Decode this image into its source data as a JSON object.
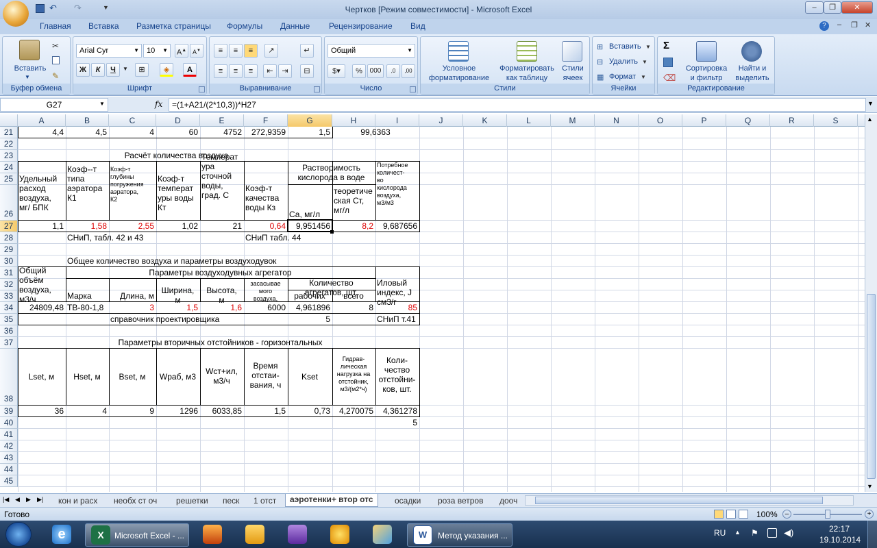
{
  "window": {
    "title": "Чертков  [Режим совместимости] - Microsoft Excel"
  },
  "ribbon": {
    "tabs": [
      "Главная",
      "Вставка",
      "Разметка страницы",
      "Формулы",
      "Данные",
      "Рецензирование",
      "Вид"
    ],
    "clipboard": {
      "label": "Буфер обмена",
      "paste": "Вставить"
    },
    "font": {
      "label": "Шрифт",
      "name": "Arial Cyr",
      "size": "10",
      "bold": "Ж",
      "italic": "К",
      "underline": "Ч"
    },
    "alignment": {
      "label": "Выравнивание"
    },
    "number": {
      "label": "Число",
      "format": "Общий",
      "percent": "%",
      "thousands": "000"
    },
    "styles": {
      "label": "Стили",
      "conditional_line1": "Условное",
      "conditional_line2": "форматирование",
      "table_line1": "Форматировать",
      "table_line2": "как таблицу",
      "cell_line1": "Стили",
      "cell_line2": "ячеек"
    },
    "cells": {
      "label": "Ячейки",
      "insert": "Вставить",
      "delete": "Удалить",
      "format": "Формат"
    },
    "editing": {
      "label": "Редактирование",
      "sigma": "Σ",
      "sort_line1": "Сортировка",
      "sort_line2": "и фильтр",
      "find_line1": "Найти и",
      "find_line2": "выделить"
    }
  },
  "formula_bar": {
    "name_box": "G27",
    "fx": "fx",
    "formula": "=(1+A21/(2*10,3))*H27"
  },
  "columns": [
    "A",
    "B",
    "C",
    "D",
    "E",
    "F",
    "G",
    "H",
    "I",
    "J",
    "K",
    "L",
    "M",
    "N",
    "O",
    "P",
    "Q",
    "R",
    "S"
  ],
  "rows": [
    "21",
    "22",
    "23",
    "24",
    "25",
    "26",
    "27",
    "28",
    "29",
    "30",
    "31",
    "32",
    "33",
    "34",
    "35",
    "36",
    "37",
    "38",
    "39",
    "40",
    "41",
    "42",
    "43",
    "44",
    "45"
  ],
  "cells": {
    "r21": [
      "4,4",
      "4,5",
      "4",
      "60",
      "4752",
      "272,9359",
      "1,5",
      "99,6363"
    ],
    "title23": "Расчёт количества воздуха",
    "h_a26": [
      "Удельный",
      "расход",
      "воздуха,",
      "мг/ БПК"
    ],
    "h_b26": [
      "Коэф--т",
      "типа",
      "аэратора",
      "К1"
    ],
    "h_c26": [
      "Коэф-т",
      "глубины",
      "погружения",
      "аэратора,",
      "К2"
    ],
    "h_d26": [
      "Коэф-т",
      "температ",
      "уры воды",
      "Кт"
    ],
    "h_e26": [
      "Температ",
      "ура",
      "сточной",
      "воды,",
      "град. С"
    ],
    "h_f26": [
      "Коэф-т",
      "качества",
      "воды Кз"
    ],
    "h_gh24": [
      "Растворимость",
      "кислорода в воде"
    ],
    "h_g26": "Са, мг/л",
    "h_h26": [
      "теоретиче",
      "ская Ст,",
      "мг/л"
    ],
    "h_i26": [
      "Потребное",
      "количест-",
      "во",
      "кислорода",
      "воздуха,",
      "м3/м3"
    ],
    "r27": [
      "1,1",
      "1,58",
      "2,55",
      "1,02",
      "21",
      "0,64",
      "9,951456",
      "8,2",
      "9,687656"
    ],
    "r28_b": "СНиП, табл. 42 и 43",
    "r28_f": "СНиП табл. 44",
    "title30": "Общее количество воздуха и параметры воздуходувок",
    "h_a31": [
      "Общий",
      "объём",
      "воздуха,",
      "м3/ч"
    ],
    "h_bh31": "Параметры воздуходувных агрегатор",
    "h_b33": "Марка",
    "h_c33": "Длина, м",
    "h_d33": [
      "Ширина,",
      "м"
    ],
    "h_e33": [
      "Высота,",
      "м"
    ],
    "h_f33": [
      "засасывае",
      "мого",
      "воздуха,"
    ],
    "h_gh32": [
      "Количество",
      "агрегатов, шт."
    ],
    "h_g33": "рабочих",
    "h_h33": "всего",
    "h_i33": [
      "Иловый",
      "индекс, J",
      "см3/г"
    ],
    "r34": [
      "24809,48",
      "ТВ-80-1,8",
      "3",
      "1,5",
      "1,6",
      "6000",
      "4,961896",
      "8",
      "85"
    ],
    "r35_c": "справочник проектировщика",
    "r35_g": "5",
    "r35_i": "СНиП т.41",
    "title37": "Параметры вторичных отстойников - горизонтальных",
    "h38": [
      "Lset, м",
      "Hset, м",
      "Bset, м",
      "Wраб, м3"
    ],
    "h_e38": [
      "Wст+ил,",
      "м3/ч"
    ],
    "h_f38": [
      "Время",
      "отстаи-",
      "вания, ч"
    ],
    "h_g38": "Kset",
    "h_h38": [
      "Гидрав-",
      "лическая",
      "нагрузка на",
      "отстойник,",
      "м3/(м2*ч)"
    ],
    "h_i38": [
      "Коли-",
      "чество",
      "отстойни-",
      "ков, шт."
    ],
    "r39": [
      "36",
      "4",
      "9",
      "1296",
      "6033,85",
      "1,5",
      "0,73",
      "4,270075",
      "4,361278"
    ],
    "r40_i": "5"
  },
  "sheet_tabs": [
    "кон и расх",
    "необх ст оч",
    "решетки",
    "песк",
    "1 отст",
    "аэротенки+ втор отс",
    "осадки",
    "роза ветров",
    "дооч"
  ],
  "active_sheet": "аэротенки+ втор отс",
  "status": {
    "ready": "Готово",
    "zoom": "100%"
  },
  "taskbar": {
    "excel": "Microsoft Excel - ...",
    "word": "Метод указания ...",
    "lang": "RU",
    "time": "22:17",
    "date": "19.10.2014"
  },
  "colors": {
    "accent": "#15428b",
    "red_values": "#dd0000",
    "taskbar": "#1f3a5e"
  }
}
